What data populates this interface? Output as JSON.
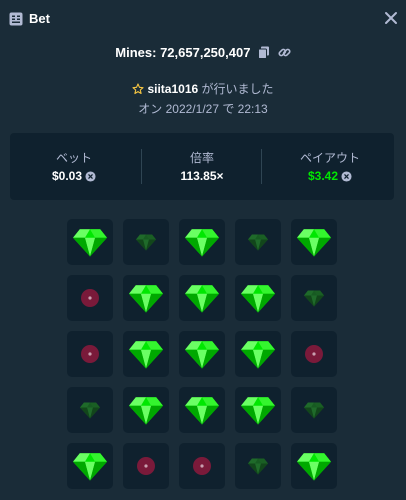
{
  "header": {
    "title": "Bet",
    "title_icon": "receipt-icon",
    "close_icon": "close-icon"
  },
  "mines": {
    "label": "Mines: 72,657,250,407",
    "copy_icon": "copy-icon",
    "link_icon": "link-icon"
  },
  "user": {
    "star_icon": "star-icon",
    "username": "siita1016",
    "suffix": " が行いました"
  },
  "date_text": "オン 2022/1/27 で 22:13",
  "stats": {
    "bet_label": "ベット",
    "bet_value": "$0.03",
    "multiplier_label": "倍率",
    "multiplier_value": "113.85×",
    "payout_label": "ペイアウト",
    "payout_value": "$3.42",
    "coin_icon": "coin-icon"
  },
  "colors": {
    "background": "#1a2c38",
    "panel": "#0f212e",
    "gem_green": "#00e701",
    "mine_red": "#7a1a3a",
    "text_muted": "#b1bad3"
  },
  "grid": {
    "rows": [
      [
        "gem",
        "gem-dim",
        "gem",
        "gem-dim",
        "gem"
      ],
      [
        "mine-dim",
        "gem",
        "gem",
        "gem",
        "gem-dim"
      ],
      [
        "mine-dim",
        "gem",
        "gem",
        "gem",
        "mine-dim"
      ],
      [
        "gem-dim",
        "gem",
        "gem",
        "gem",
        "gem-dim"
      ],
      [
        "gem",
        "mine-dim",
        "mine-dim",
        "gem-dim",
        "gem"
      ]
    ]
  }
}
